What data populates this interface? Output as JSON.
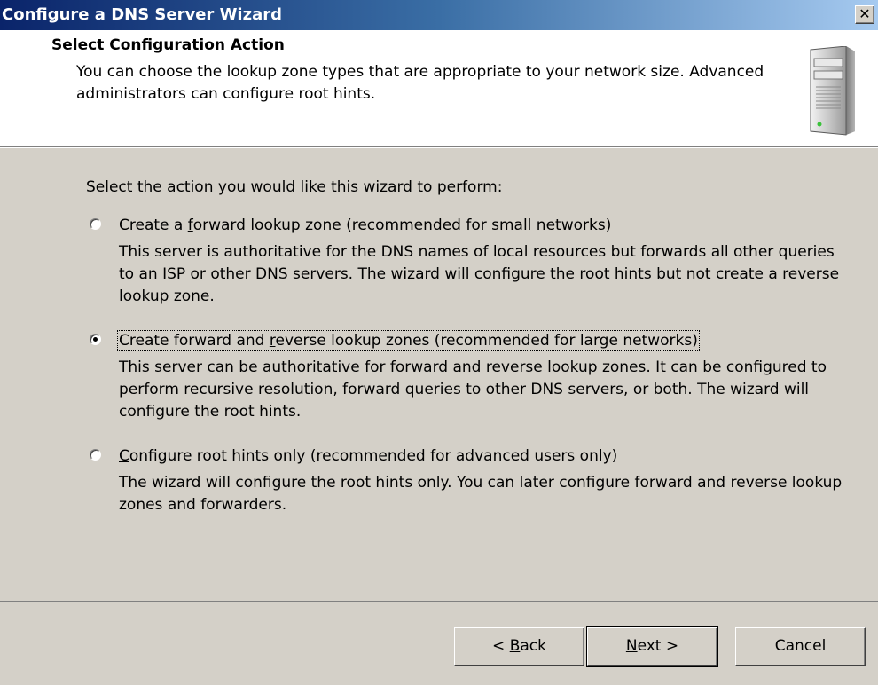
{
  "window": {
    "title": "Configure a DNS Server Wizard",
    "close_glyph": "✕"
  },
  "header": {
    "title": "Select Configuration Action",
    "description": "You can choose the lookup zone types that are appropriate to your network size. Advanced administrators can configure root hints.",
    "icon": "server-icon"
  },
  "body": {
    "prompt": "Select the action you would like this wizard to perform:",
    "selected_option": 1,
    "options": [
      {
        "label_pre": "Create a ",
        "label_key": "f",
        "label_post": "orward lookup zone (recommended for small networks)",
        "description": "This server is authoritative for the DNS names of local resources but forwards all other queries to an ISP or other DNS servers. The wizard will configure the root hints but not create a reverse lookup zone."
      },
      {
        "label_pre": "Create forward and ",
        "label_key": "r",
        "label_post": "everse lookup zones (recommended for large networks)",
        "description": "This server can be authoritative for forward and reverse lookup zones. It can be configured to perform recursive resolution, forward queries to other DNS servers, or both. The wizard will configure the root hints."
      },
      {
        "label_pre": "",
        "label_key": "C",
        "label_post": "onfigure root hints only (recommended for advanced users only)",
        "description": "The wizard will configure the root hints only. You can later configure forward and reverse lookup zones and forwarders."
      }
    ]
  },
  "buttons": {
    "back": {
      "pre": "< ",
      "key": "B",
      "post": "ack"
    },
    "next": {
      "pre": "",
      "key": "N",
      "post": "ext >"
    },
    "cancel": {
      "label": "Cancel"
    }
  },
  "colors": {
    "titlebar_start": "#0a246a",
    "titlebar_end": "#a6caf0",
    "dialog_bg": "#d4d0c8",
    "header_bg": "#ffffff"
  }
}
